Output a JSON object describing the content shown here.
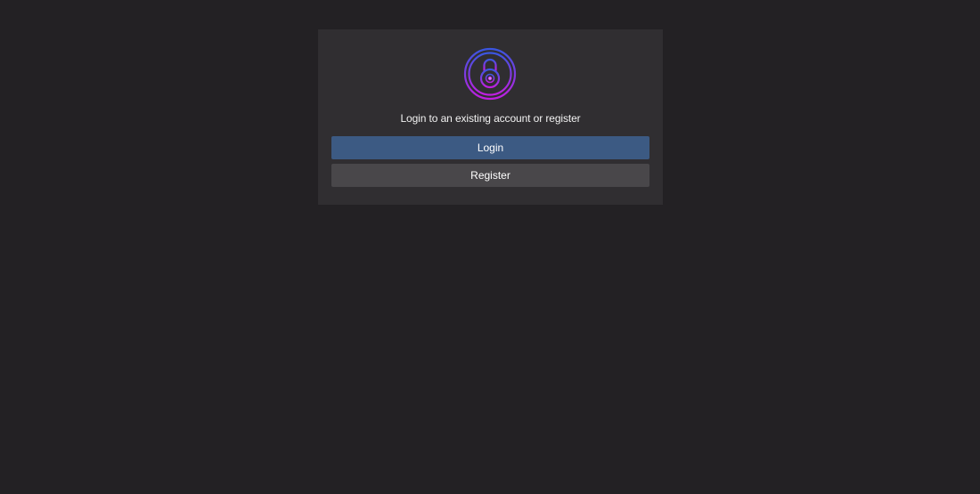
{
  "card": {
    "logo_icon": "padlock-icon",
    "prompt": "Login to an existing account or register",
    "login_label": "Login",
    "register_label": "Register"
  },
  "colors": {
    "page_background": "#232124",
    "card_background": "#302e31",
    "login_button": "#3c5a83",
    "register_button": "#49474a",
    "logo_gradient_start": "#3a56e0",
    "logo_gradient_end": "#c11fe0"
  }
}
